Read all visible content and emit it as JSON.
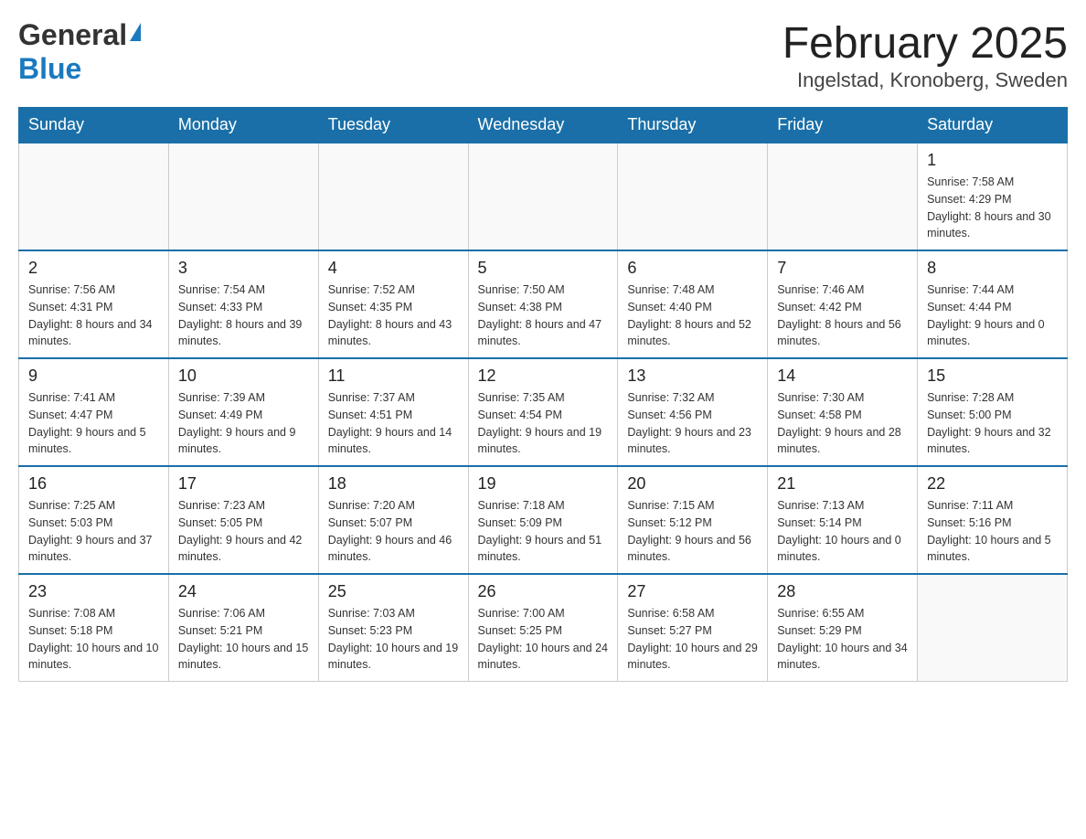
{
  "header": {
    "logo_general": "General",
    "logo_blue": "Blue",
    "month_title": "February 2025",
    "location": "Ingelstad, Kronoberg, Sweden"
  },
  "days_of_week": [
    "Sunday",
    "Monday",
    "Tuesday",
    "Wednesday",
    "Thursday",
    "Friday",
    "Saturday"
  ],
  "weeks": [
    [
      {
        "day": "",
        "info": ""
      },
      {
        "day": "",
        "info": ""
      },
      {
        "day": "",
        "info": ""
      },
      {
        "day": "",
        "info": ""
      },
      {
        "day": "",
        "info": ""
      },
      {
        "day": "",
        "info": ""
      },
      {
        "day": "1",
        "info": "Sunrise: 7:58 AM\nSunset: 4:29 PM\nDaylight: 8 hours and 30 minutes."
      }
    ],
    [
      {
        "day": "2",
        "info": "Sunrise: 7:56 AM\nSunset: 4:31 PM\nDaylight: 8 hours and 34 minutes."
      },
      {
        "day": "3",
        "info": "Sunrise: 7:54 AM\nSunset: 4:33 PM\nDaylight: 8 hours and 39 minutes."
      },
      {
        "day": "4",
        "info": "Sunrise: 7:52 AM\nSunset: 4:35 PM\nDaylight: 8 hours and 43 minutes."
      },
      {
        "day": "5",
        "info": "Sunrise: 7:50 AM\nSunset: 4:38 PM\nDaylight: 8 hours and 47 minutes."
      },
      {
        "day": "6",
        "info": "Sunrise: 7:48 AM\nSunset: 4:40 PM\nDaylight: 8 hours and 52 minutes."
      },
      {
        "day": "7",
        "info": "Sunrise: 7:46 AM\nSunset: 4:42 PM\nDaylight: 8 hours and 56 minutes."
      },
      {
        "day": "8",
        "info": "Sunrise: 7:44 AM\nSunset: 4:44 PM\nDaylight: 9 hours and 0 minutes."
      }
    ],
    [
      {
        "day": "9",
        "info": "Sunrise: 7:41 AM\nSunset: 4:47 PM\nDaylight: 9 hours and 5 minutes."
      },
      {
        "day": "10",
        "info": "Sunrise: 7:39 AM\nSunset: 4:49 PM\nDaylight: 9 hours and 9 minutes."
      },
      {
        "day": "11",
        "info": "Sunrise: 7:37 AM\nSunset: 4:51 PM\nDaylight: 9 hours and 14 minutes."
      },
      {
        "day": "12",
        "info": "Sunrise: 7:35 AM\nSunset: 4:54 PM\nDaylight: 9 hours and 19 minutes."
      },
      {
        "day": "13",
        "info": "Sunrise: 7:32 AM\nSunset: 4:56 PM\nDaylight: 9 hours and 23 minutes."
      },
      {
        "day": "14",
        "info": "Sunrise: 7:30 AM\nSunset: 4:58 PM\nDaylight: 9 hours and 28 minutes."
      },
      {
        "day": "15",
        "info": "Sunrise: 7:28 AM\nSunset: 5:00 PM\nDaylight: 9 hours and 32 minutes."
      }
    ],
    [
      {
        "day": "16",
        "info": "Sunrise: 7:25 AM\nSunset: 5:03 PM\nDaylight: 9 hours and 37 minutes."
      },
      {
        "day": "17",
        "info": "Sunrise: 7:23 AM\nSunset: 5:05 PM\nDaylight: 9 hours and 42 minutes."
      },
      {
        "day": "18",
        "info": "Sunrise: 7:20 AM\nSunset: 5:07 PM\nDaylight: 9 hours and 46 minutes."
      },
      {
        "day": "19",
        "info": "Sunrise: 7:18 AM\nSunset: 5:09 PM\nDaylight: 9 hours and 51 minutes."
      },
      {
        "day": "20",
        "info": "Sunrise: 7:15 AM\nSunset: 5:12 PM\nDaylight: 9 hours and 56 minutes."
      },
      {
        "day": "21",
        "info": "Sunrise: 7:13 AM\nSunset: 5:14 PM\nDaylight: 10 hours and 0 minutes."
      },
      {
        "day": "22",
        "info": "Sunrise: 7:11 AM\nSunset: 5:16 PM\nDaylight: 10 hours and 5 minutes."
      }
    ],
    [
      {
        "day": "23",
        "info": "Sunrise: 7:08 AM\nSunset: 5:18 PM\nDaylight: 10 hours and 10 minutes."
      },
      {
        "day": "24",
        "info": "Sunrise: 7:06 AM\nSunset: 5:21 PM\nDaylight: 10 hours and 15 minutes."
      },
      {
        "day": "25",
        "info": "Sunrise: 7:03 AM\nSunset: 5:23 PM\nDaylight: 10 hours and 19 minutes."
      },
      {
        "day": "26",
        "info": "Sunrise: 7:00 AM\nSunset: 5:25 PM\nDaylight: 10 hours and 24 minutes."
      },
      {
        "day": "27",
        "info": "Sunrise: 6:58 AM\nSunset: 5:27 PM\nDaylight: 10 hours and 29 minutes."
      },
      {
        "day": "28",
        "info": "Sunrise: 6:55 AM\nSunset: 5:29 PM\nDaylight: 10 hours and 34 minutes."
      },
      {
        "day": "",
        "info": ""
      }
    ]
  ]
}
